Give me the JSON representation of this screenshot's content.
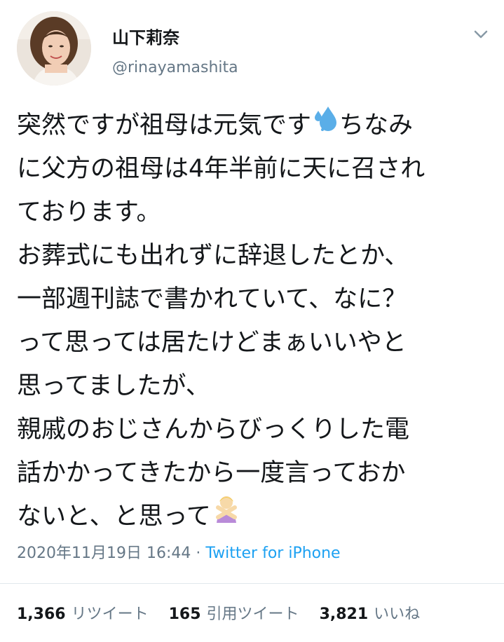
{
  "user": {
    "display_name": "山下莉奈",
    "handle": "@rinayamashita"
  },
  "tweet": {
    "lines": [
      "突然ですが祖母は元気です",
      "ちなみ",
      "に父方の祖母は4年半前に天に召され",
      "ております。",
      "お葬式にも出れずに辞退したとか、",
      "一部週刊誌で書かれていて、なに？",
      "って思っては居たけどまぁいいやと",
      "思ってましたが、",
      "親戚のおじさんからびっくりした電",
      "話かかってきたから一度言っておか",
      "ないと、と思って"
    ],
    "emoji": [
      "sweat-droplets-icon",
      "person-gesturing-no-icon"
    ]
  },
  "meta": {
    "timestamp": "2020年11月19日 16:44",
    "separator": " · ",
    "source": "Twitter for iPhone"
  },
  "stats": {
    "retweets_count": "1,366",
    "retweets_label": "リツイート",
    "quotes_count": "165",
    "quotes_label": "引用ツイート",
    "likes_count": "3,821",
    "likes_label": "いいね"
  },
  "colors": {
    "text": "#14171a",
    "secondary": "#657786",
    "link": "#1da1f2",
    "divider": "#e1e8ed",
    "emoji_sweat": "#5aaee8"
  }
}
